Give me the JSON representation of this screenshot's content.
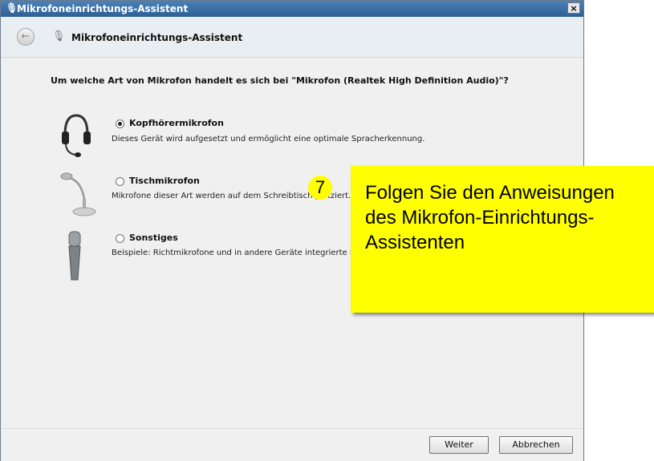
{
  "window": {
    "title": "Mikrofoneinrichtungs-Assistent",
    "close_label": "×"
  },
  "nav": {
    "title": "Mikrofoneinrichtungs-Assistent"
  },
  "content": {
    "question": "Um welche Art von Mikrofon handelt es sich bei \"Mikrofon (Realtek High Definition Audio)\"?",
    "options": [
      {
        "label": "Kopfhörermikrofon",
        "description": "Dieses Gerät wird aufgesetzt und ermöglicht eine optimale Spracherkennung.",
        "selected": true,
        "icon": "headset-icon"
      },
      {
        "label": "Tischmikrofon",
        "description": "Mikrofone dieser Art werden auf dem Schreibtisch platziert.",
        "selected": false,
        "icon": "desk-microphone-icon"
      },
      {
        "label": "Sonstiges",
        "description": "Beispiele: Richtmikrofone und in andere Geräte integrierte Mikrofone.",
        "selected": false,
        "icon": "handheld-microphone-icon"
      }
    ]
  },
  "buttons": {
    "next": "Weiter",
    "cancel": "Abbrechen"
  },
  "callout": {
    "step_number": "7",
    "text": "Folgen Sie den Anweisungen des Mikrofon-Einrichtungs-Assistenten",
    "color": "#ffff00"
  }
}
